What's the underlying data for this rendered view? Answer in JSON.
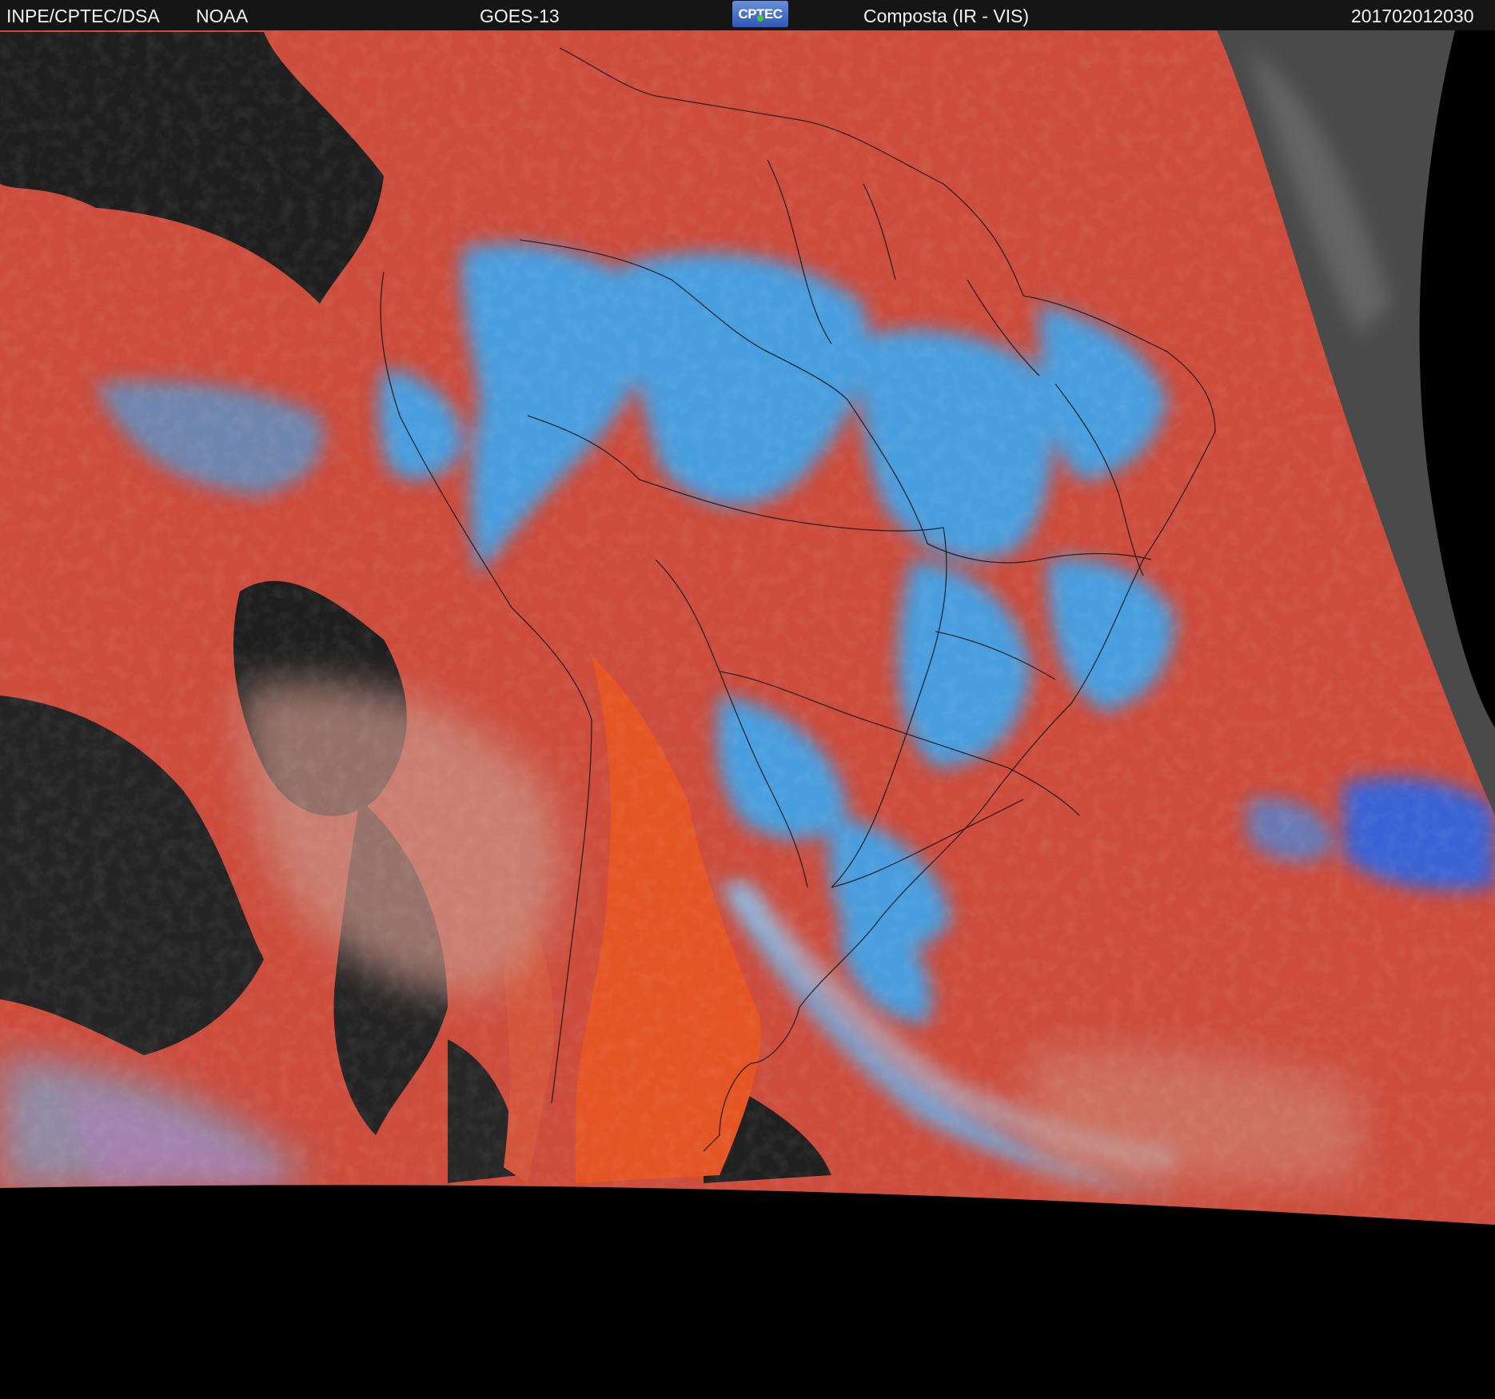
{
  "header": {
    "institution": "INPE/CPTEC/DSA",
    "agency": "NOAA",
    "satellite": "GOES-13",
    "logo_text": "CPTEC",
    "product": "Composta (IR - VIS)",
    "timestamp": "201702012030"
  },
  "colors": {
    "clear_land": "#cf4c3a",
    "clear_ocean": "#d2503f",
    "hot_desert": "#e8541e",
    "high_cloud": "#39a6f0",
    "deep_convection": "#2a6fe8",
    "low_cloud": "#c8c4b0",
    "dark_land": "#1c1c1c",
    "no_data": "#000000"
  },
  "map": {
    "icons": [
      "country-borders",
      "state-borders",
      "coastline"
    ]
  }
}
